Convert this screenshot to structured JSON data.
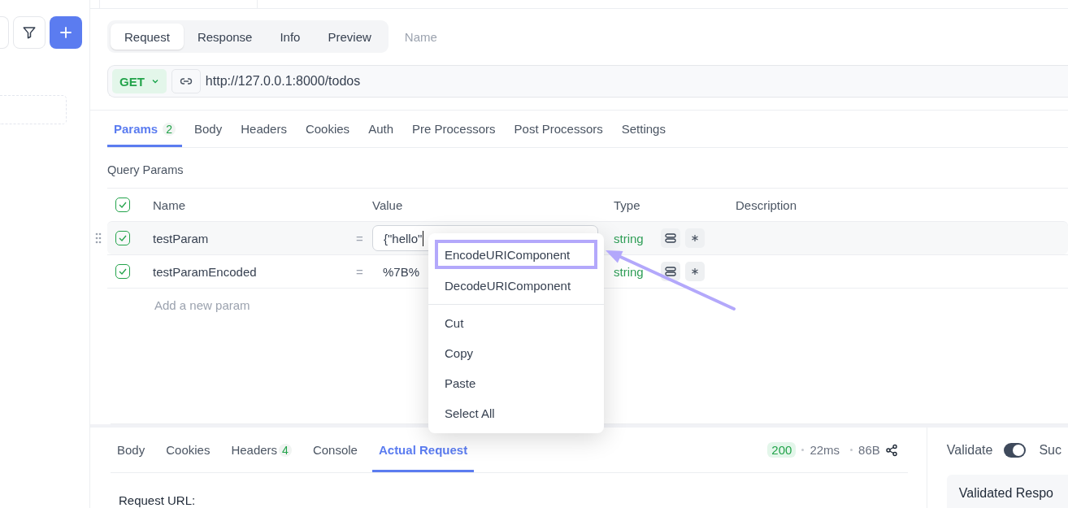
{
  "request_tabs": [
    {
      "label": "Request",
      "selected": true
    },
    {
      "label": "Response",
      "selected": false
    },
    {
      "label": "Info",
      "selected": false
    },
    {
      "label": "Preview",
      "selected": false
    }
  ],
  "name_field": {
    "placeholder": "Name"
  },
  "url_bar": {
    "method": "GET",
    "url": "http://127.0.0.1:8000/todos"
  },
  "param_tabs": [
    {
      "label": "Params",
      "count": "2",
      "selected": true
    },
    {
      "label": "Body",
      "selected": false
    },
    {
      "label": "Headers",
      "selected": false
    },
    {
      "label": "Cookies",
      "selected": false
    },
    {
      "label": "Auth",
      "selected": false
    },
    {
      "label": "Pre Processors",
      "selected": false
    },
    {
      "label": "Post Processors",
      "selected": false
    },
    {
      "label": "Settings",
      "selected": false
    }
  ],
  "query_params": {
    "title": "Query Params",
    "header_checked": true,
    "columns": [
      "Name",
      "Value",
      "Type",
      "Description"
    ],
    "rows": [
      {
        "checked": true,
        "name": "testParam",
        "operator": "=",
        "value": "{\"hello\"",
        "focused": true,
        "type": "string"
      },
      {
        "checked": true,
        "name": "testParamEncoded",
        "operator": "=",
        "value": "%7B%",
        "focused": false,
        "type": "string"
      }
    ],
    "add_placeholder": "Add a new param"
  },
  "context_menu": {
    "groups": [
      [
        {
          "label": "EncodeURIComponent",
          "highlighted": true
        },
        {
          "label": "DecodeURIComponent",
          "highlighted": false
        }
      ],
      [
        {
          "label": "Cut",
          "highlighted": false
        },
        {
          "label": "Copy",
          "highlighted": false
        },
        {
          "label": "Paste",
          "highlighted": false
        },
        {
          "label": "Select All",
          "highlighted": false
        }
      ]
    ]
  },
  "response": {
    "tabs": [
      {
        "label": "Body",
        "selected": false
      },
      {
        "label": "Cookies",
        "selected": false
      },
      {
        "label": "Headers",
        "count": "4",
        "selected": false
      },
      {
        "label": "Console",
        "selected": false
      },
      {
        "label": "Actual Request",
        "selected": true
      }
    ],
    "status": "200",
    "time": "22ms",
    "size": "86B",
    "request_url_label": "Request URL:"
  },
  "validation": {
    "label": "Validate",
    "on": true,
    "result": "Suc",
    "card_title": "Validated Respo"
  }
}
